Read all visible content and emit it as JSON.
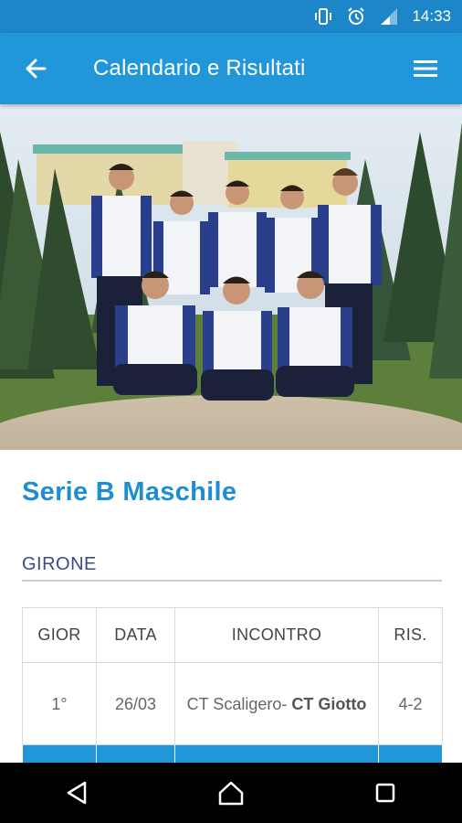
{
  "status_bar": {
    "time": "14:33",
    "icons": [
      "vibrate-icon",
      "alarm-icon",
      "signal-icon"
    ]
  },
  "app_bar": {
    "title": "Calendario e Risultati",
    "back_icon": "arrow-back-icon",
    "menu_icon": "hamburger-menu-icon"
  },
  "hero_image": {
    "description_icon": "team-photo"
  },
  "main": {
    "section_title": "Serie B Maschile",
    "group_label": "GIRONE",
    "table": {
      "headers": [
        "GIOR",
        "DATA",
        "INCONTRO",
        "RIS."
      ],
      "rows": [
        {
          "round": "1°",
          "date": "26/03",
          "home": "CT Scaligero-",
          "away": "CT Giotto",
          "result": "4-2"
        }
      ]
    }
  },
  "nav_bar": {
    "icons": [
      "back-triangle-icon",
      "home-icon",
      "recents-square-icon"
    ]
  },
  "colors": {
    "status_bar": "#1c86c9",
    "app_bar": "#2196d8",
    "accent_title": "#1f8ed0",
    "group_label": "#3a4a8a"
  }
}
